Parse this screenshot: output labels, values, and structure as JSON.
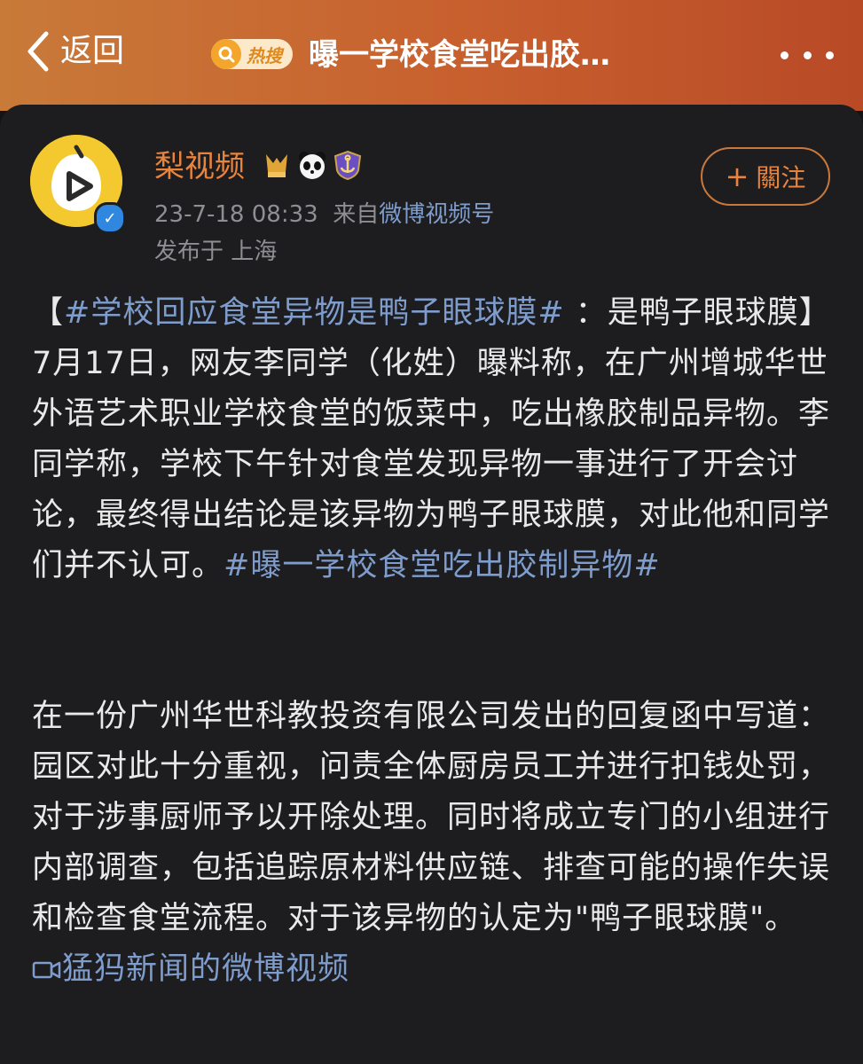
{
  "header": {
    "back_label": "返回",
    "hot_badge_text": "热搜",
    "topic_title": "曝一学校食堂吃出胶…"
  },
  "post": {
    "author_name": "梨视频",
    "date": "23-7-18 08:33",
    "source_prefix": "来自",
    "source_name": "微博视频号",
    "location": "发布于 上海",
    "follow_label": "關注",
    "paragraph1": {
      "bracket_open": "【",
      "hashtag1": "#学校回应食堂异物是鸭子眼球膜#",
      "text1": " ：是鸭子眼球膜】7月17日，网友李同学（化姓）曝料称，在广州增城华世外语艺术职业学校食堂的饭菜中，吃出橡胶制品异物。李同学称，学校下午针对食堂发现异物一事进行了开会讨论，最终得出结论是该异物为鸭子眼球膜，对此他和同学们并不认可。",
      "hashtag2": "#曝一学校食堂吃出胶制异物#"
    },
    "paragraph2": {
      "text": "在一份广州华世科教投资有限公司发出的回复函中写道：园区对此十分重视，问责全体厨房员工并进行扣钱处罚，对于涉事厨师予以开除处理。同时将成立专门的小组进行内部调查，包括追踪原材料供应链、排查可能的操作失误和检查食堂流程。对于该异物的认定为\"鸭子眼球膜\"。 ",
      "video_link": "猛犸新闻的微博视频"
    }
  },
  "colors": {
    "header_gradient_start": "#c87a39",
    "header_gradient_end": "#b84a26",
    "author_orange": "#e8843e",
    "link_blue": "#7e9ccc",
    "card_background": "#1d1d1f"
  },
  "icons": {
    "back": "chevron-left-icon",
    "more": "ellipsis-icon",
    "verified": "verified-check-icon",
    "video": "video-camera-icon"
  }
}
